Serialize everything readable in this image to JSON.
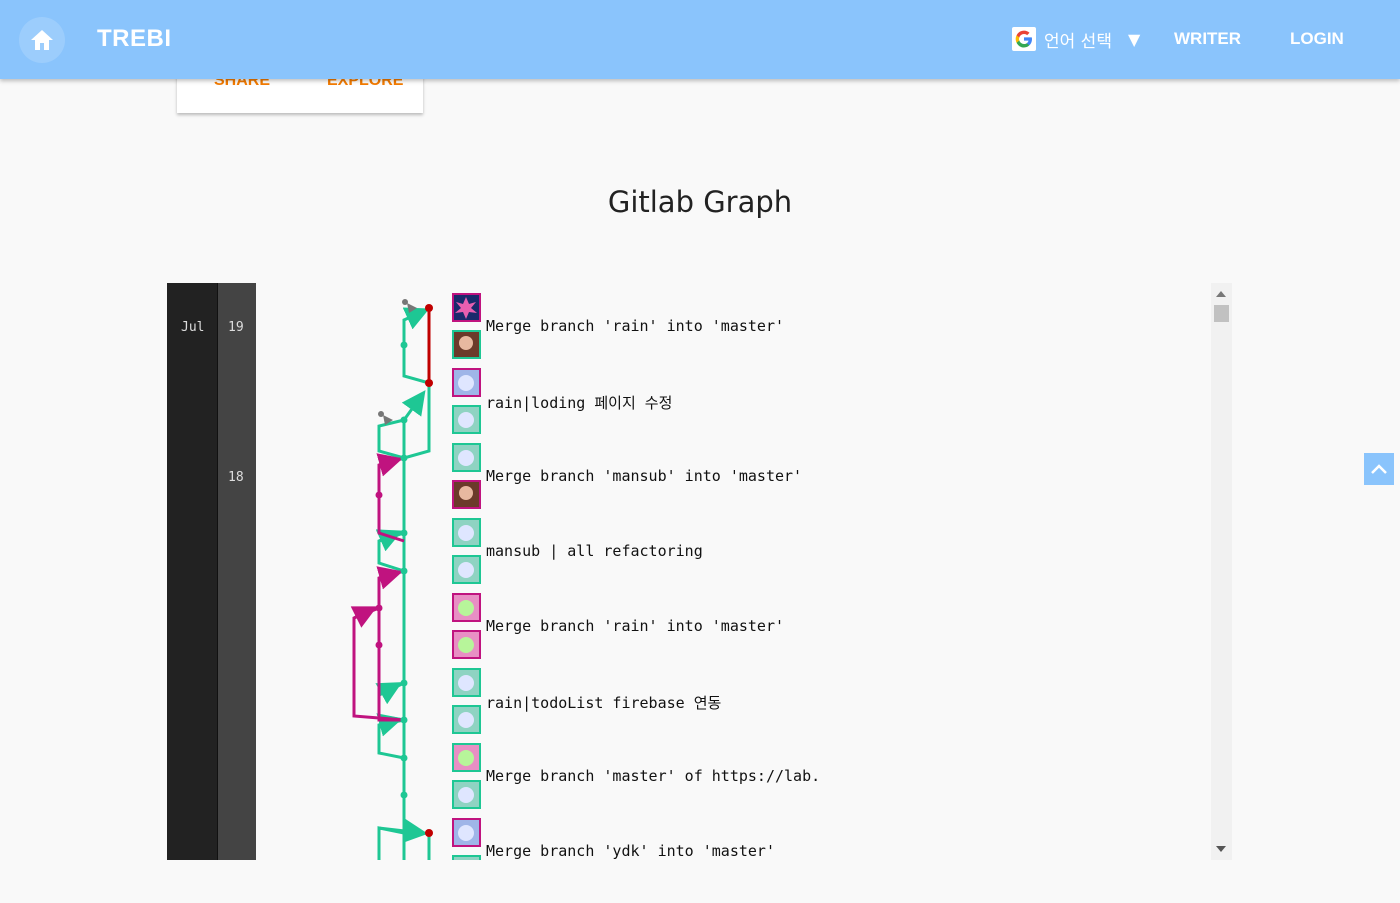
{
  "header": {
    "brand": "TREBI",
    "language_label": "언어 선택",
    "caret": "▼",
    "writer_label": "WRITER",
    "login_label": "LOGIN"
  },
  "dropdown": {
    "share_label": "SHARE",
    "explore_label": "EXPLORE"
  },
  "page": {
    "title": "Gitlab Graph"
  },
  "timeline": {
    "month": "Jul",
    "days": [
      "19",
      "18"
    ]
  },
  "commits": [
    "Merge branch 'rain' into 'master'",
    "rain|loding 페이지 수정",
    "Merge branch 'mansub' into 'master'",
    "mansub | all refactoring",
    "Merge branch 'rain' into 'master'",
    "rain|todoList firebase 연동",
    "Merge branch 'master' of https://lab.ssafy.com",
    "Merge branch 'ydk' into 'master'"
  ],
  "colors": {
    "topbar": "#8ac4fc",
    "branch_master": "#1ec794",
    "branch_feature": "#c0137f",
    "branch_head": "#c00000",
    "accent_orange": "#f57c00"
  },
  "icons": [
    "home-icon",
    "google-icon",
    "chevron-up-icon"
  ]
}
